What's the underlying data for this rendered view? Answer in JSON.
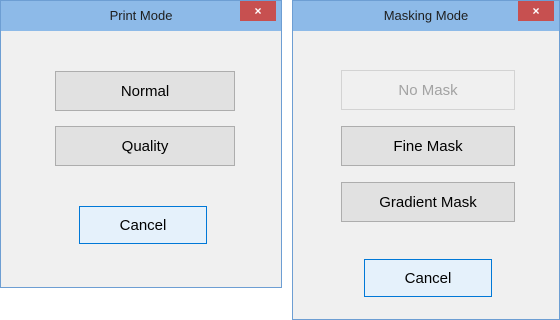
{
  "print_dialog": {
    "title": "Print Mode",
    "close_glyph": "×",
    "buttons": {
      "normal": "Normal",
      "quality": "Quality",
      "cancel": "Cancel"
    }
  },
  "masking_dialog": {
    "title": "Masking Mode",
    "close_glyph": "×",
    "buttons": {
      "no_mask": "No Mask",
      "no_mask_state": "disabled",
      "fine_mask": "Fine Mask",
      "gradient_mask": "Gradient Mask",
      "cancel": "Cancel"
    }
  },
  "colors": {
    "titlebar": "#8dbae8",
    "close_button": "#c75050",
    "dialog_background": "#f0f0f0",
    "default_button_border": "#0078d7"
  }
}
